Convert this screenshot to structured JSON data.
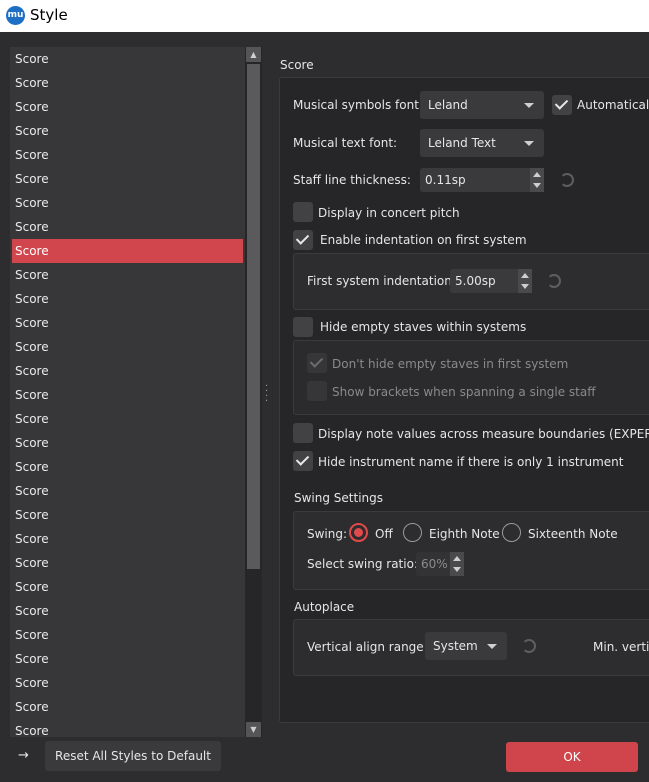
{
  "window": {
    "title": "Style",
    "icon": "musescore-logo-icon",
    "icon_text": "mu"
  },
  "sidebar": {
    "items": [
      "Score",
      "Score",
      "Score",
      "Score",
      "Score",
      "Score",
      "Score",
      "Score",
      "Score",
      "Score",
      "Score",
      "Score",
      "Score",
      "Score",
      "Score",
      "Score",
      "Score",
      "Score",
      "Score",
      "Score",
      "Score",
      "Score",
      "Score",
      "Score",
      "Score",
      "Score",
      "Score",
      "Score",
      "Score"
    ],
    "selected_index": 8
  },
  "score": {
    "title": "Score",
    "musical_symbols_font_label": "Musical symbols font:",
    "musical_symbols_font_value": "Leland",
    "auto_checkbox_label": "Automatically",
    "auto_checked": true,
    "musical_text_font_label": "Musical text font:",
    "musical_text_font_value": "Leland Text",
    "staff_line_label": "Staff line thickness:",
    "staff_line_value": "0.11sp",
    "concert_pitch_label": "Display in concert pitch",
    "concert_pitch_checked": false,
    "indentation_label": "Enable indentation on first system",
    "indentation_checked": true,
    "first_indent_label": "First system indentation:",
    "first_indent_value": "5.00sp",
    "hide_empty_label": "Hide empty staves within systems",
    "hide_empty_checked": false,
    "dont_hide_first_label": "Don't hide empty staves in first system",
    "dont_hide_first_checked": true,
    "show_brackets_label": "Show brackets when spanning a single staff",
    "show_brackets_checked": false,
    "note_values_label": "Display note values across measure boundaries (EXPERIMEN",
    "note_values_checked": false,
    "hide_instrument_label": "Hide instrument name if there is only 1 instrument",
    "hide_instrument_checked": true
  },
  "swing": {
    "title": "Swing Settings",
    "swing_label": "Swing:",
    "options": [
      "Off",
      "Eighth Note",
      "Sixteenth Note"
    ],
    "selected": "Off",
    "ratio_label": "Select swing ratio:",
    "ratio_value": "60%"
  },
  "autoplace": {
    "title": "Autoplace",
    "vertical_align_label": "Vertical align range:",
    "vertical_align_value": "System",
    "min_vertical_label": "Min. vertic"
  },
  "footer": {
    "arrow": "→",
    "reset_label": "Reset All Styles to Default",
    "ok_label": "OK"
  },
  "colors": {
    "accent": "#cf454b",
    "background": "#2d2d30",
    "panel": "#262628"
  }
}
